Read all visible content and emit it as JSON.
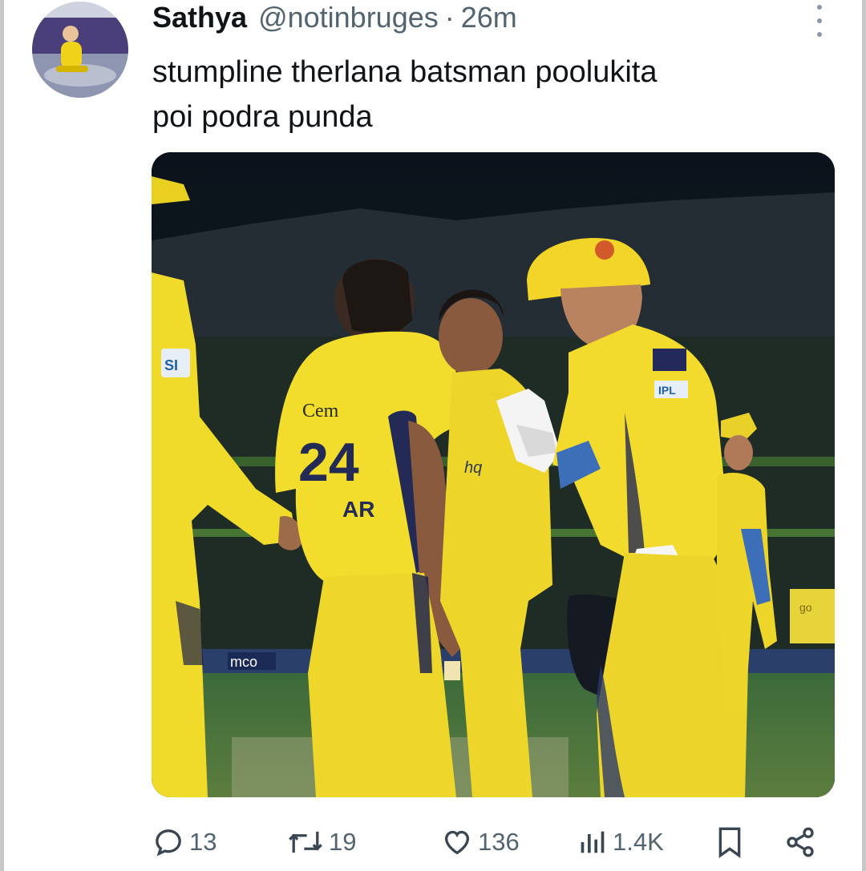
{
  "tweet": {
    "display_name": "Sathya",
    "handle": "@notinbruges",
    "separator": "·",
    "time": "26m",
    "text_lines": [
      "stumpline therlana batsman poolukita",
      "poi podra punda"
    ]
  },
  "media": {
    "jersey_number": "24",
    "jersey_text": "AR",
    "sponsor_text": "Cem",
    "badge_text": "IPL",
    "board_text": "mco",
    "sign_text": "go"
  },
  "actions": {
    "replies": "13",
    "retweets": "19",
    "likes": "136",
    "views": "1.4K"
  },
  "colors": {
    "text": "#0f1419",
    "secondary": "#536471",
    "jersey_yellow": "#f4e02a"
  },
  "icons": [
    "more-icon",
    "reply-icon",
    "retweet-icon",
    "like-icon",
    "views-icon",
    "bookmark-icon",
    "share-icon"
  ]
}
